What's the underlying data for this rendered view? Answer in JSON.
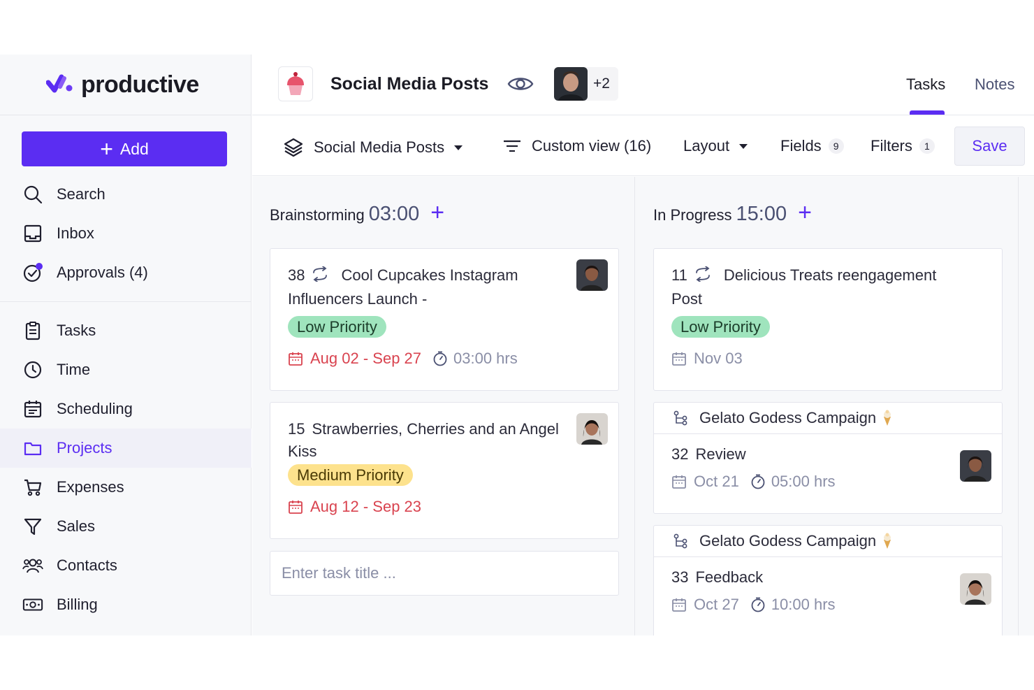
{
  "brand": {
    "name": "productive",
    "accent": "#5b2df2"
  },
  "sidebar": {
    "add_label": "Add",
    "top_items": [
      {
        "label": "Search",
        "icon": "search-icon"
      },
      {
        "label": "Inbox",
        "icon": "inbox-icon"
      },
      {
        "label": "Approvals (4)",
        "icon": "approvals-icon"
      }
    ],
    "main_items": [
      {
        "label": "Tasks",
        "icon": "clipboard-icon"
      },
      {
        "label": "Time",
        "icon": "clock-icon"
      },
      {
        "label": "Scheduling",
        "icon": "calendar-icon"
      },
      {
        "label": "Projects",
        "icon": "folder-icon",
        "active": true
      },
      {
        "label": "Expenses",
        "icon": "cart-icon"
      },
      {
        "label": "Sales",
        "icon": "funnel-icon"
      },
      {
        "label": "Contacts",
        "icon": "contacts-icon"
      },
      {
        "label": "Billing",
        "icon": "money-icon"
      }
    ]
  },
  "header": {
    "project_title": "Social Media Posts",
    "project_icon": "cupcake-icon",
    "members_more": "+2",
    "tabs": [
      {
        "label": "Tasks",
        "active": true
      },
      {
        "label": "Notes",
        "active": false
      }
    ]
  },
  "toolbar": {
    "board_select": "Social Media Posts",
    "view": "Custom view (16)",
    "layout": "Layout",
    "fields_label": "Fields",
    "fields_count": "9",
    "filters_label": "Filters",
    "filters_count": "1",
    "save_label": "Save"
  },
  "columns": [
    {
      "name": "Brainstorming",
      "time": "03:00",
      "cards": [
        {
          "number": "38",
          "title": "Cool Cupcakes Instagram Influencers Launch -",
          "recurring": true,
          "priority": "Low Priority",
          "dates": "Aug 02 - Sep 27",
          "hours": "03:00 hrs"
        },
        {
          "number": "15",
          "title": "Strawberries, Cherries and an Angel Kiss",
          "recurring": false,
          "priority": "Medium Priority",
          "dates": "Aug 12 - Sep 23"
        }
      ],
      "input_placeholder": "Enter task title ..."
    },
    {
      "name": "In Progress",
      "time": "15:00",
      "cards": [
        {
          "number": "11",
          "title": "Delicious Treats reengagement Post",
          "recurring": true,
          "priority": "Low Priority",
          "dates": "Nov 03"
        },
        {
          "parent": "Gelato Godess Campaign",
          "number": "32",
          "title": "Review",
          "dates": "Oct 21",
          "hours": "05:00 hrs"
        },
        {
          "parent": "Gelato Godess Campaign",
          "number": "33",
          "title": "Feedback",
          "dates": "Oct 27",
          "hours": "10:00 hrs"
        }
      ]
    }
  ]
}
